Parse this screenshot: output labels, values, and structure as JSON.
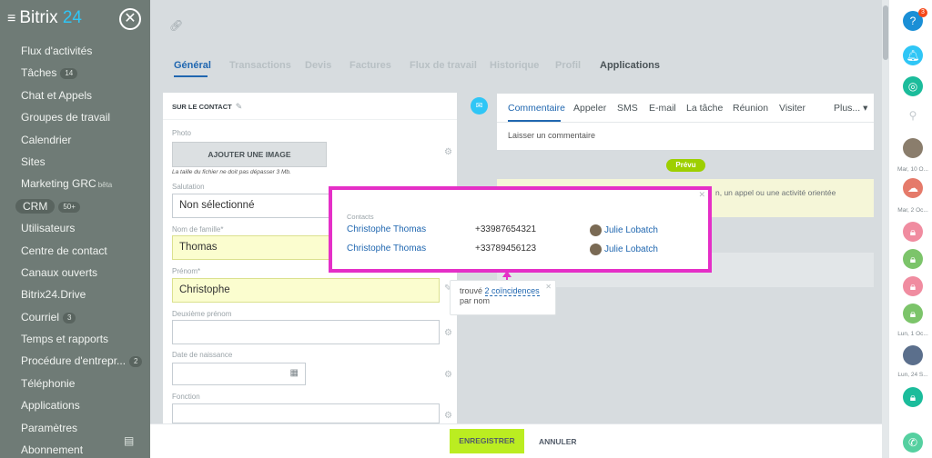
{
  "app": {
    "logo_main": "Bitrix",
    "logo_num": "24",
    "close_glyph": "✕"
  },
  "sidebar": {
    "items": [
      {
        "label": "Flux d'activités"
      },
      {
        "label": "Tâches",
        "count": "14"
      },
      {
        "label": "Chat et Appels"
      },
      {
        "label": "Groupes de travail"
      },
      {
        "label": "Calendrier"
      },
      {
        "label": "Sites"
      },
      {
        "label": "Marketing GRC",
        "beta": "bêta"
      },
      {
        "label": "CRM",
        "count": "50+",
        "active": true
      },
      {
        "label": "Utilisateurs"
      },
      {
        "label": "Centre de contact"
      },
      {
        "label": "Canaux ouverts"
      },
      {
        "label": "Bitrix24.Drive"
      },
      {
        "label": "Courriel",
        "count": "3"
      },
      {
        "label": "Temps et rapports"
      },
      {
        "label": "Procédure d'entrepr...",
        "count": "2"
      },
      {
        "label": "Téléphonie"
      },
      {
        "label": "Applications"
      },
      {
        "label": "Paramètres"
      },
      {
        "label": "Abonnement"
      }
    ]
  },
  "tabs": [
    "Général",
    "Transactions",
    "Devis",
    "Factures",
    "Flux de travail",
    "Historique",
    "Profil",
    "Applications"
  ],
  "form": {
    "title": "SUR LE CONTACT",
    "photo_label": "Photo",
    "add_image": "AJOUTER UNE IMAGE",
    "file_hint": "La taille du fichier ne doit pas dépasser 3 Mb.",
    "salutation_label": "Salutation",
    "salutation_value": "Non sélectionné",
    "lastname_label": "Nom de famille*",
    "lastname_value": "Thomas",
    "firstname_label": "Prénom*",
    "firstname_value": "Christophe",
    "middlename_label": "Deuxième prénom",
    "birthdate_label": "Date de naissance",
    "function_label": "Fonction"
  },
  "comment": {
    "tabs": [
      "Commentaire",
      "Appeler",
      "SMS",
      "E-mail",
      "La tâche",
      "Réunion",
      "Visiter",
      "Plus..."
    ],
    "placeholder": "Laisser un commentaire"
  },
  "timeline": {
    "prevu": "Prévu",
    "plan_text": "n, un appel ou une activité orientée"
  },
  "popup": {
    "caption": "Contacts",
    "rows": [
      {
        "name": "Christophe Thomas",
        "phone": "+33987654321",
        "user": "Julie Lobatch"
      },
      {
        "name": "Christophe Thomas",
        "phone": "+33789456123",
        "user": "Julie Lobatch"
      }
    ]
  },
  "found": {
    "prefix": "trouvé",
    "link": "2 coïncidences",
    "suffix": "par nom"
  },
  "bottom": {
    "save": "ENREGISTRER",
    "cancel": "ANNULER"
  },
  "rightbar": {
    "help_badge": "3",
    "dates": [
      "Mar, 10 O...",
      "Mar, 2 Oc...",
      "Lun, 1 Oc...",
      "Lun, 24 S..."
    ]
  },
  "colors": {
    "accent": "#2067b0",
    "highlight": "#e52fc7",
    "save": "#bbed21",
    "sidebar": "#6f7b76"
  }
}
